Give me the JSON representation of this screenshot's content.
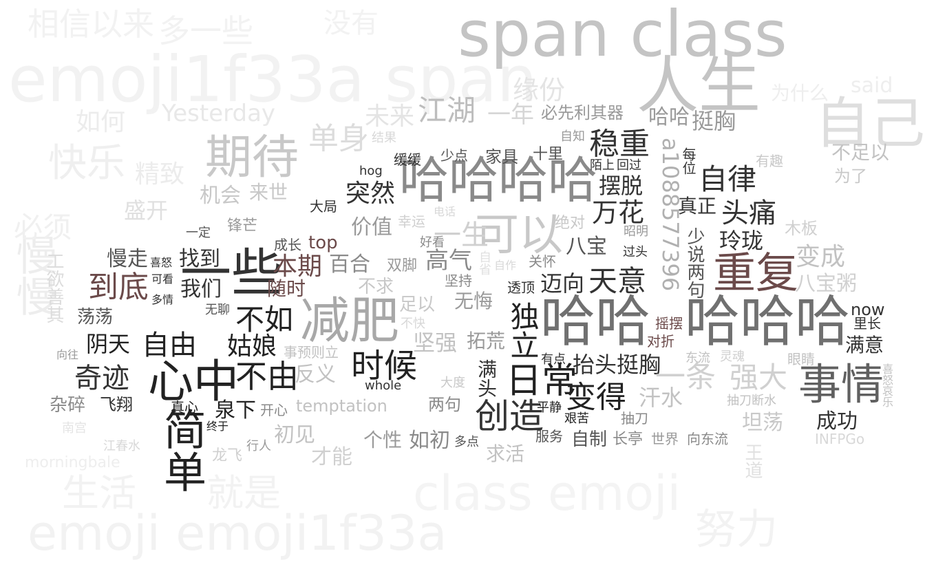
{
  "colors": {
    "background": "#ffffff",
    "dark": "#1e1e1e",
    "mauve": "#6b4a4a",
    "gray": "#7a7a7a",
    "light": "#c2c2c2",
    "faint": "#ececec"
  },
  "words": [
    {
      "text": "span class",
      "color": "#c4c4c4"
    },
    {
      "text": "emoji1f33a span",
      "color": "#f2f2f2"
    },
    {
      "text": "人生",
      "color": "#c4c4c4"
    },
    {
      "text": "自己",
      "color": "#dedede"
    },
    {
      "text": "期待",
      "color": "#c8c8c8"
    },
    {
      "text": "快乐",
      "color": "#efefef"
    },
    {
      "text": "Yesterday",
      "color": "#e8e8e8"
    },
    {
      "text": "缘份",
      "color": "#e4e4e4"
    },
    {
      "text": "江湖",
      "color": "#bdbdbd"
    },
    {
      "text": "一年",
      "color": "#d6d6d6"
    },
    {
      "text": "必先利其器",
      "color": "#9a9a9a"
    },
    {
      "text": "哈哈",
      "color": "#9a9a9a"
    },
    {
      "text": "挺胸",
      "color": "#9a9a9a"
    },
    {
      "text": "稳重",
      "color": "#333333"
    },
    {
      "text": "单身",
      "color": "#dcdcdc"
    },
    {
      "text": "未来",
      "color": "#e4e4e4"
    },
    {
      "text": "哈哈哈哈",
      "color": "#8a8a8a"
    },
    {
      "text": "哈哈",
      "color": "#707070"
    },
    {
      "text": "哈哈哈",
      "color": "#707070"
    },
    {
      "text": "a1088577396",
      "color": "#b0b0b0"
    },
    {
      "text": "自律",
      "color": "#333333"
    },
    {
      "text": "头痛",
      "color": "#333333"
    },
    {
      "text": "重复",
      "color": "#6b4a4a"
    },
    {
      "text": "玲珑",
      "color": "#333333"
    },
    {
      "text": "变成",
      "color": "#c2c2c2"
    },
    {
      "text": "八宝粥",
      "color": "#d0d0d0"
    },
    {
      "text": "不足以",
      "color": "#c2c2c2"
    },
    {
      "text": "为了",
      "color": "#c8c8c8"
    },
    {
      "text": "有趣",
      "color": "#c8c8c8"
    },
    {
      "text": "木板",
      "color": "#d0d0d0"
    },
    {
      "text": "now",
      "color": "#333333"
    },
    {
      "text": "里长",
      "color": "#333333"
    },
    {
      "text": "满意",
      "color": "#333333"
    },
    {
      "text": "事情",
      "color": "#606060"
    },
    {
      "text": "强大",
      "color": "#d0d0d0"
    },
    {
      "text": "坦荡",
      "color": "#c8c8c8"
    },
    {
      "text": "成功",
      "color": "#333333"
    },
    {
      "text": "INFPGo",
      "color": "#d8d8d8"
    },
    {
      "text": "减肥",
      "color": "#a8a8a8"
    },
    {
      "text": "一些",
      "color": "#333333"
    },
    {
      "text": "心中",
      "color": "#222222"
    },
    {
      "text": "不由",
      "color": "#222222"
    },
    {
      "text": "简单",
      "color": "#222222"
    },
    {
      "text": "到底",
      "color": "#6b4a4a"
    },
    {
      "text": "本期",
      "color": "#6b4a4a"
    },
    {
      "text": "随时",
      "color": "#6b4a4a"
    },
    {
      "text": "不如",
      "color": "#222222"
    },
    {
      "text": "姑娘",
      "color": "#222222"
    },
    {
      "text": "时候",
      "color": "#222222"
    },
    {
      "text": "日常",
      "color": "#222222"
    },
    {
      "text": "变得",
      "color": "#222222"
    },
    {
      "text": "创造",
      "color": "#333333"
    },
    {
      "text": "独立",
      "color": "#222222"
    },
    {
      "text": "天意",
      "color": "#333333"
    },
    {
      "text": "万花",
      "color": "#333333"
    },
    {
      "text": "八宝",
      "color": "#555555"
    },
    {
      "text": "摆脱",
      "color": "#333333"
    },
    {
      "text": "可以",
      "color": "#c8c8c8"
    },
    {
      "text": "一生",
      "color": "#d0d0d0"
    },
    {
      "text": "突然",
      "color": "#333333"
    },
    {
      "text": "价值",
      "color": "#9a9a9a"
    },
    {
      "text": "高气",
      "color": "#8a8a8a"
    },
    {
      "text": "百合",
      "color": "#8a8a8a"
    },
    {
      "text": "迈向",
      "color": "#333333"
    },
    {
      "text": "抬头挺胸",
      "color": "#333333"
    },
    {
      "text": "一条",
      "color": "#d0d0d0"
    },
    {
      "text": "汗水",
      "color": "#c2c2c2"
    },
    {
      "text": "奇迹",
      "color": "#333333"
    },
    {
      "text": "阴天",
      "color": "#222222"
    },
    {
      "text": "自由",
      "color": "#222222"
    },
    {
      "text": "我们",
      "color": "#333333"
    },
    {
      "text": "找到",
      "color": "#333333"
    },
    {
      "text": "慢走",
      "color": "#555555"
    },
    {
      "text": "荡荡",
      "color": "#555555"
    },
    {
      "text": "杂碎",
      "color": "#8a8a8a"
    },
    {
      "text": "飞翔",
      "color": "#333333"
    },
    {
      "text": "真心",
      "color": "#222222"
    },
    {
      "text": "泉下",
      "color": "#222222"
    },
    {
      "text": "开心",
      "color": "#8a8a8a"
    },
    {
      "text": "temptation",
      "color": "#c2c2c2"
    },
    {
      "text": "两句",
      "color": "#8a8a8a"
    },
    {
      "text": "初见",
      "color": "#c2c2c2"
    },
    {
      "text": "才能",
      "color": "#d0d0d0"
    },
    {
      "text": "个性",
      "color": "#9a9a9a"
    },
    {
      "text": "如初",
      "color": "#8a8a8a"
    },
    {
      "text": "求活",
      "color": "#c2c2c2"
    },
    {
      "text": "服务",
      "color": "#555555"
    },
    {
      "text": "自制",
      "color": "#555555"
    },
    {
      "text": "长亭",
      "color": "#8a8a8a"
    },
    {
      "text": "世界",
      "color": "#9a9a9a"
    },
    {
      "text": "向东流",
      "color": "#8a8a8a"
    },
    {
      "text": "坚强",
      "color": "#c2c2c2"
    },
    {
      "text": "拓荒",
      "color": "#9a9a9a"
    },
    {
      "text": "反义",
      "color": "#c2c2c2"
    },
    {
      "text": "无悔",
      "color": "#9a9a9a"
    },
    {
      "text": "双脚",
      "color": "#9a9a9a"
    },
    {
      "text": "不求",
      "color": "#c8c8c8"
    },
    {
      "text": "足以",
      "color": "#c8c8c8"
    },
    {
      "text": "top",
      "color": "#6b4a4a"
    },
    {
      "text": "机会",
      "color": "#c8c8c8"
    },
    {
      "text": "来世",
      "color": "#c8c8c8"
    },
    {
      "text": "盛开",
      "color": "#e0e0e0"
    },
    {
      "text": "锋芒",
      "color": "#9a9a9a"
    },
    {
      "text": "成长",
      "color": "#555555"
    },
    {
      "text": "大局",
      "color": "#333333"
    },
    {
      "text": "家具",
      "color": "#555555"
    },
    {
      "text": "十里",
      "color": "#555555"
    },
    {
      "text": "少点",
      "color": "#555555"
    },
    {
      "text": "缓缓",
      "color": "#333333"
    },
    {
      "text": "hog",
      "color": "#333333"
    },
    {
      "text": "幸运",
      "color": "#d0d0d0"
    },
    {
      "text": "好看",
      "color": "#8a8a8a"
    },
    {
      "text": "绝对",
      "color": "#c8c8c8"
    },
    {
      "text": "陌上",
      "color": "#333333"
    },
    {
      "text": "回过",
      "color": "#333333"
    },
    {
      "text": "自知",
      "color": "#9a9a9a"
    },
    {
      "text": "每位",
      "color": "#333333"
    },
    {
      "text": "真正",
      "color": "#333333"
    },
    {
      "text": "少说两句",
      "color": "#555555"
    },
    {
      "text": "昭明",
      "color": "#9a9a9a"
    },
    {
      "text": "过头",
      "color": "#333333"
    },
    {
      "text": "关怀",
      "color": "#8a8a8a"
    },
    {
      "text": "透顶",
      "color": "#333333"
    },
    {
      "text": "摇摆",
      "color": "#6b4a4a"
    },
    {
      "text": "对折",
      "color": "#6b4a4a"
    },
    {
      "text": "有点",
      "color": "#333333"
    },
    {
      "text": "满头",
      "color": "#333333"
    },
    {
      "text": "平静",
      "color": "#222222"
    },
    {
      "text": "艰苦",
      "color": "#222222"
    },
    {
      "text": "抽刀",
      "color": "#8a8a8a"
    },
    {
      "text": "东流",
      "color": "#c2c2c2"
    },
    {
      "text": "灵魂",
      "color": "#d0d0d0"
    },
    {
      "text": "抽刀断水",
      "color": "#c2c2c2"
    },
    {
      "text": "眼睛",
      "color": "#c2c2c2"
    },
    {
      "text": "喜怒哀乐",
      "color": "#c2c2c2"
    },
    {
      "text": "王道",
      "color": "#e0e0e0"
    },
    {
      "text": "whole",
      "color": "#333333"
    },
    {
      "text": "大度",
      "color": "#c8c8c8"
    },
    {
      "text": "不快",
      "color": "#d8d8d8"
    },
    {
      "text": "事预则立",
      "color": "#c2c2c2"
    },
    {
      "text": "无聊",
      "color": "#555555"
    },
    {
      "text": "一定",
      "color": "#555555"
    },
    {
      "text": "喜怒",
      "color": "#333333"
    },
    {
      "text": "可看",
      "color": "#333333"
    },
    {
      "text": "多情",
      "color": "#333333"
    },
    {
      "text": "向往",
      "color": "#9a9a9a"
    },
    {
      "text": "终于",
      "color": "#222222"
    },
    {
      "text": "行人",
      "color": "#9a9a9a"
    },
    {
      "text": "龙飞",
      "color": "#d0d0d0"
    },
    {
      "text": "江春水",
      "color": "#d8d8d8"
    },
    {
      "text": "多点",
      "color": "#555555"
    },
    {
      "text": "坚持",
      "color": "#8a8a8a"
    },
    {
      "text": "结果",
      "color": "#d8d8d8"
    },
    {
      "text": "电话",
      "color": "#d8d8d8"
    },
    {
      "text": "自作",
      "color": "#d8d8d8"
    },
    {
      "text": "自省",
      "color": "#e0e0e0"
    },
    {
      "text": "慢慢",
      "color": "#ededed"
    },
    {
      "text": "工欲善其",
      "color": "#dcdcdc"
    },
    {
      "text": "如何",
      "color": "#ececec"
    },
    {
      "text": "精致",
      "color": "#ececec"
    },
    {
      "text": "必须",
      "color": "#f0f0f0"
    },
    {
      "text": "emoji emoji1f33a",
      "color": "#f2f2f2"
    },
    {
      "text": "class emoji",
      "color": "#f4f4f4"
    },
    {
      "text": "生活",
      "color": "#f2f2f2"
    },
    {
      "text": "就是",
      "color": "#f2f2f2"
    },
    {
      "text": "努力",
      "color": "#f2f2f2"
    },
    {
      "text": "相信以来",
      "color": "#f2f2f2"
    },
    {
      "text": "多一些",
      "color": "#f2f2f2"
    },
    {
      "text": "没有",
      "color": "#f2f2f2"
    },
    {
      "text": "morningbale",
      "color": "#eeeeee"
    },
    {
      "text": "南宫",
      "color": "#e4e4e4"
    },
    {
      "text": "为什么",
      "color": "#eeeeee"
    },
    {
      "text": "said",
      "color": "#eeeeee"
    }
  ]
}
